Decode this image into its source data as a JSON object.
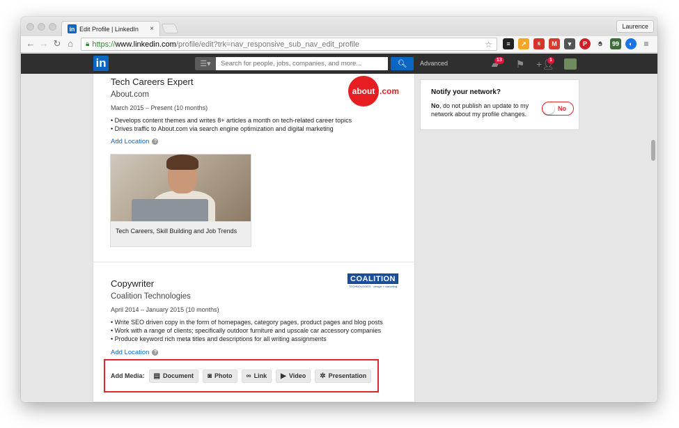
{
  "browser": {
    "tab_title": "Edit Profile | LinkedIn",
    "tab_close": "×",
    "profile_name": "Laurence",
    "url_scheme": "https://",
    "url_host": "www.linkedin.com",
    "url_path": "/profile/edit?trk=nav_responsive_sub_nav_edit_profile",
    "ext_badges": {
      "ublock": "6"
    }
  },
  "linkedin_nav": {
    "logo_text": "in",
    "search_placeholder": "Search for people, jobs, companies, and more...",
    "advanced_label": "Advanced",
    "messages_count": "13",
    "connections_count": "1"
  },
  "positions": [
    {
      "title": "Tech Careers Expert",
      "company": "About.com",
      "dates": "March 2015 – Present (10 months)",
      "bullets": [
        "• Develops content themes and writes 8+ articles a month on tech-related career topics",
        "• Drives traffic to About.com via search engine optimization and digital marketing"
      ],
      "add_location": "Add Location",
      "logo_text": "about",
      "logo_suffix": ".com",
      "media_caption": "Tech Careers, Skill Building and Job Trends"
    },
    {
      "title": "Copywriter",
      "company": "Coalition Technologies",
      "dates": "April 2014 – January 2015 (10 months)",
      "bullets": [
        "• Write SEO driven copy in the form of homepages, category pages, product pages and blog posts",
        "• Work with a range of clients; specifically outdoor furniture and upscale car accessory companies",
        "• Produce keyword rich meta titles and descriptions for all writing assignments"
      ],
      "add_location": "Add Location",
      "logo_text": "COALITION",
      "logo_sub": "TECHNOLOGIES · design + marketing"
    }
  ],
  "add_media": {
    "label": "Add Media:",
    "buttons": [
      "Document",
      "Photo",
      "Link",
      "Video",
      "Presentation"
    ]
  },
  "notify": {
    "title": "Notify your network?",
    "text_bold": "No",
    "text_rest": ", do not publish an update to my network about my profile changes.",
    "toggle_label": "No"
  },
  "colors": {
    "linkedin_blue": "#0a66c2",
    "highlight_red": "#e0262c",
    "about_red": "#e61e22"
  }
}
